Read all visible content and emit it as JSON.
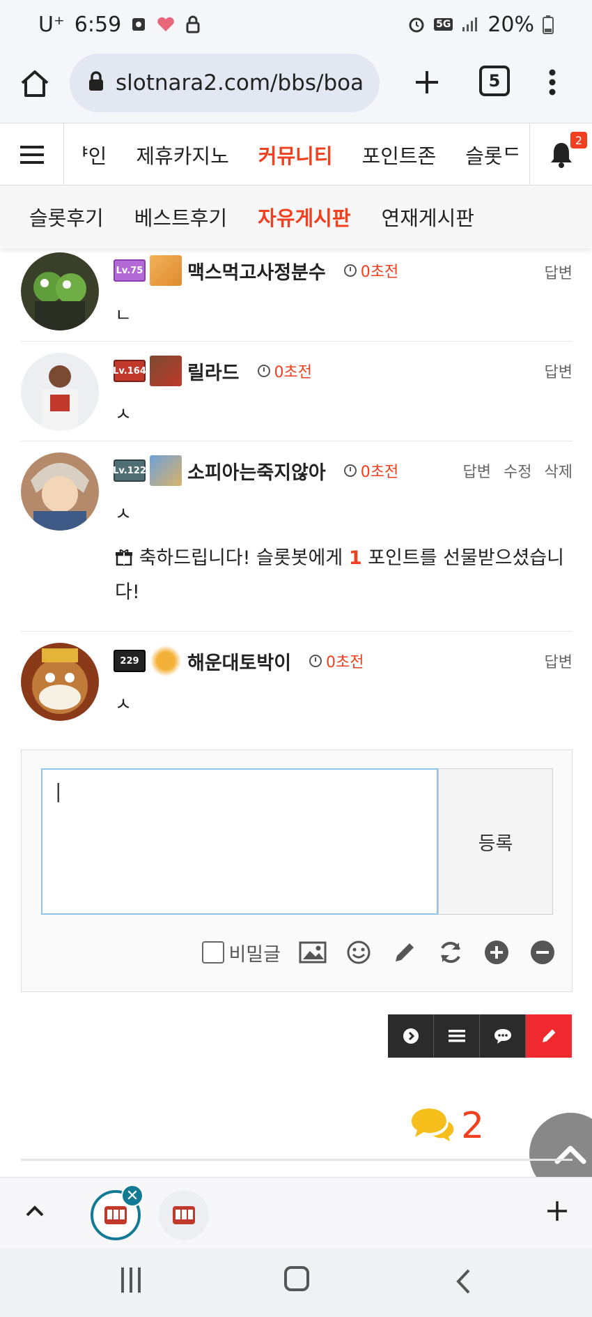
{
  "status": {
    "carrier": "U⁺",
    "time": "6:59",
    "network": "5G",
    "battery": "20%"
  },
  "browser": {
    "url": "slotnara2.com/bbs/boa",
    "tab_count": "5"
  },
  "site_nav": {
    "items": [
      "ᅣ인",
      "제휴카지노",
      "커뮤니티",
      "포인트존",
      "슬롯ᄃ"
    ],
    "active_index": 2,
    "notification_count": "2"
  },
  "sub_nav": {
    "items": [
      "슬롯후기",
      "베스트후기",
      "자유게시판",
      "연재게시판"
    ],
    "active_index": 2
  },
  "comments": [
    {
      "level": "Lv.75",
      "name": "맥스먹고사정분수",
      "time": "0초전",
      "body": "ㄴ",
      "actions": [
        "답변"
      ]
    },
    {
      "level": "Lv.164",
      "name": "릴라드",
      "time": "0초전",
      "body": "ㅅ",
      "actions": [
        "답변"
      ]
    },
    {
      "level": "Lv.122",
      "name": "소피아는죽지않아",
      "time": "0초전",
      "body": "ㅅ",
      "actions": [
        "답변",
        "수정",
        "삭제"
      ],
      "gift_pre": " 축하드립니다! 슬롯봇에게 ",
      "gift_num": "1",
      "gift_post": " 포인트를 선물받으셨습니다!"
    },
    {
      "level": "229",
      "name": "해운대토박이",
      "time": "0초전",
      "body": "ㅅ",
      "actions": [
        "답변"
      ]
    }
  ],
  "reply": {
    "input_value": "|",
    "submit_label": "등록",
    "secret_label": "비밀글"
  },
  "comment_count": "2",
  "colors": {
    "accent": "#f0401f",
    "tab_active": "#127a95",
    "write_button": "#f02830"
  }
}
